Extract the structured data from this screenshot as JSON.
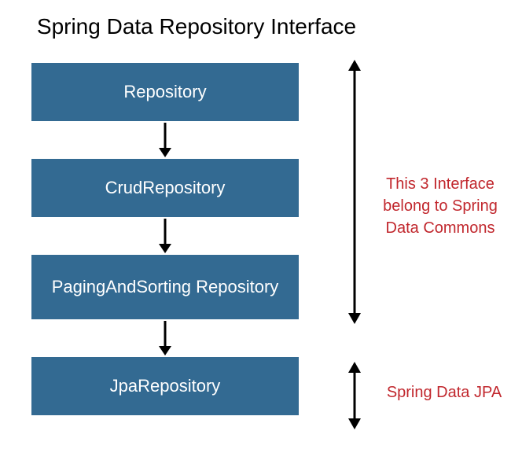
{
  "title": "Spring Data Repository Interface",
  "boxes": {
    "box1": "Repository",
    "box2": "CrudRepository",
    "box3": "PagingAndSorting Repository",
    "box4": "JpaRepository"
  },
  "annotations": {
    "group1": "This 3 Interface belong to Spring Data Commons",
    "group2": "Spring Data JPA"
  },
  "colors": {
    "box_bg": "#336a92",
    "annotation_text": "#c1272d"
  }
}
